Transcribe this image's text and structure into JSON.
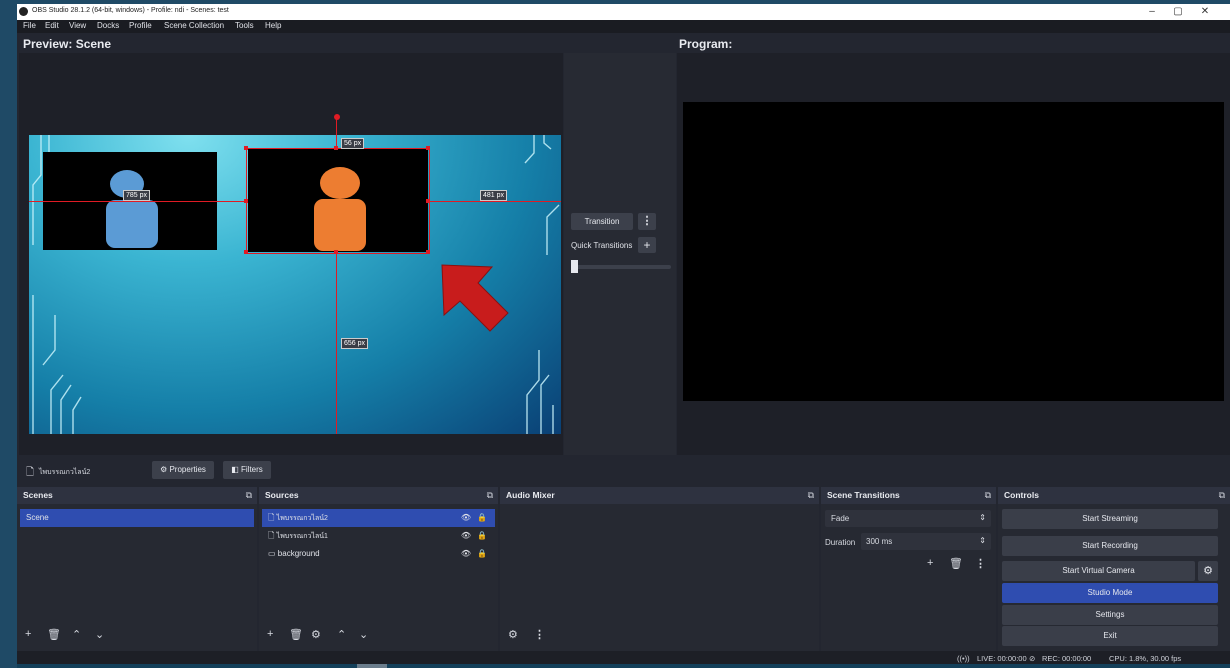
{
  "window": {
    "title": "OBS Studio 28.1.2 (64-bit, windows) - Profile: ndi - Scenes: test",
    "minimize": "–",
    "maximize": "▢",
    "close": "✕"
  },
  "menu": [
    "File",
    "Edit",
    "View",
    "Docks",
    "Profile",
    "Scene Collection",
    "Tools",
    "Help"
  ],
  "preview": {
    "heading": "Preview: Scene",
    "guides": {
      "top": "56 px",
      "left": "785 px",
      "right": "481 px",
      "bottom": "656 px"
    }
  },
  "program": {
    "heading": "Program:"
  },
  "transition_panel": {
    "transition_label": "Transition",
    "more_icon": "⋮",
    "quick_transitions_label": "Quick Transitions",
    "add_icon": "+",
    "tbar_value": 0
  },
  "source_toolbar": {
    "selected_source": "ไพบรรณกวไลน์2",
    "properties_label": "Properties",
    "filters_label": "Filters"
  },
  "scenes": {
    "title": "Scenes",
    "items": [
      "Scene"
    ],
    "selected": 0
  },
  "sources": {
    "title": "Sources",
    "items": [
      {
        "name": "ไพบรรณกวไลน์2",
        "icon": "file-icon"
      },
      {
        "name": "ไพบรรณกวไลน์1",
        "icon": "file-icon"
      },
      {
        "name": "background",
        "icon": "image-icon"
      }
    ],
    "selected": 0
  },
  "audio_mixer": {
    "title": "Audio Mixer"
  },
  "scene_transitions": {
    "title": "Scene Transitions",
    "type_value": "Fade",
    "duration_label": "Duration",
    "duration_value": "300 ms"
  },
  "controls": {
    "title": "Controls",
    "start_streaming": "Start Streaming",
    "start_recording": "Start Recording",
    "start_virtual_camera": "Start Virtual Camera",
    "studio_mode": "Studio Mode",
    "settings": "Settings",
    "exit": "Exit"
  },
  "status": {
    "live": "LIVE: 00:00:00",
    "rec": "REC: 00:00:00",
    "cpu": "CPU: 1.8%, 30.00 fps"
  },
  "colors": {
    "selected": "#2f4db0",
    "guide": "#e01b24",
    "arrow": "#c81c1c",
    "person_blue": "#5b9bd5",
    "person_orange": "#ed7d31"
  }
}
